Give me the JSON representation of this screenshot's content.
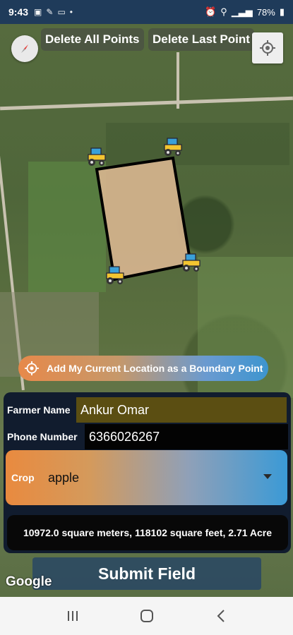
{
  "status_bar": {
    "time": "9:43",
    "left_icons": [
      "image-icon",
      "tools-icon",
      "laptop-icon",
      "dot-icon"
    ],
    "right_icons": [
      "alarm-icon",
      "location-icon",
      "signal-icon"
    ],
    "battery": "78%"
  },
  "map": {
    "delete_all_label": "Delete All Points",
    "delete_last_label": "Delete Last Point",
    "google_logo": "Google"
  },
  "add_location_label": "Add My Current Location as a Boundary Point",
  "form": {
    "farmer_name_label": "Farmer Name",
    "farmer_name_value": "Ankur Omar",
    "phone_label": "Phone Number",
    "phone_value": "6366026267",
    "crop_label": "Crop",
    "crop_value": "apple"
  },
  "area_text": "10972.0 square meters, 118102 square feet, 2.71 Acre",
  "submit_label": "Submit Field",
  "colors": {
    "status_bar": "#1f3b5a",
    "panel_bg": "#111c2e",
    "farmer_name_bg": "#5b4e12",
    "accent_orange": "#e98a3f",
    "accent_blue": "#3b9ad6"
  }
}
